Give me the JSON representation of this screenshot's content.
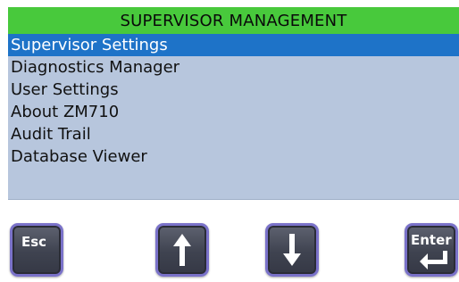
{
  "title": "SUPERVISOR MANAGEMENT",
  "colors": {
    "title_bar": "#48c93c",
    "selected_row": "#1e73c8",
    "panel_bg": "#b7c6dd",
    "button_border": "#7a72c9",
    "button_face": "#474a57"
  },
  "menu": {
    "items": [
      {
        "label": "Supervisor Settings",
        "selected": true
      },
      {
        "label": "Diagnostics Manager",
        "selected": false
      },
      {
        "label": "User Settings",
        "selected": false
      },
      {
        "label": "About ZM710",
        "selected": false
      },
      {
        "label": "Audit Trail",
        "selected": false
      },
      {
        "label": "Database Viewer",
        "selected": false
      }
    ]
  },
  "buttons": {
    "esc": {
      "label": "Esc",
      "icon": "esc-icon"
    },
    "up": {
      "label": "",
      "icon": "arrow-up-icon"
    },
    "down": {
      "label": "",
      "icon": "arrow-down-icon"
    },
    "enter": {
      "label": "Enter",
      "icon": "enter-return-icon"
    }
  }
}
